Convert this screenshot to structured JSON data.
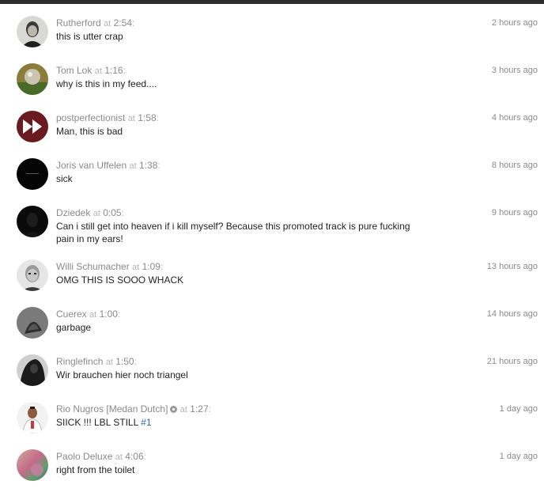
{
  "comments": [
    {
      "username": "Rutherford",
      "at": "at",
      "timestamp": "2:54",
      "colon": ":",
      "text": "this is utter crap",
      "posted": "2 hours ago",
      "avatar": "avatar-portrait-bw"
    },
    {
      "username": "Tom Lok",
      "at": "at",
      "timestamp": "1:16",
      "colon": ":",
      "text": "why is this in my feed....",
      "posted": "3 hours ago",
      "avatar": "avatar-disco-ball"
    },
    {
      "username": "postperfectionist",
      "at": "at",
      "timestamp": "1:58",
      "colon": ":",
      "text": "Man, this is bad",
      "posted": "4 hours ago",
      "avatar": "fast-forward-icon"
    },
    {
      "username": "Joris van Uffelen",
      "at": "at",
      "timestamp": "1:38",
      "colon": ":",
      "text": "sick",
      "posted": "8 hours ago",
      "avatar": "avatar-black"
    },
    {
      "username": "Dziedek",
      "at": "at",
      "timestamp": "0:05",
      "colon": ":",
      "text_line1": "Can i still get into heaven if i kill myself? Because this promoted track is pure fucking",
      "text_line2": "pain in my ears!",
      "posted": "9 hours ago",
      "avatar": "avatar-dark-silhouette"
    },
    {
      "username": "Willi Schumacher",
      "at": "at",
      "timestamp": "1:09",
      "colon": ":",
      "text": "OMG THIS IS SOOO WHACK",
      "posted": "13 hours ago",
      "avatar": "avatar-face-bw"
    },
    {
      "username": "Cuerex",
      "at": "at",
      "timestamp": "1:00",
      "colon": ":",
      "text": "garbage",
      "posted": "14 hours ago",
      "avatar": "avatar-hooded-figure"
    },
    {
      "username": "Ringlefinch",
      "at": "at",
      "timestamp": "1:50",
      "colon": ":",
      "text": "Wir brauchen hier noch triangel",
      "posted": "21 hours ago",
      "avatar": "avatar-dark-portrait"
    },
    {
      "username": "Rio Nugros [Medan Dutch]",
      "at": "at",
      "timestamp": "1:27",
      "colon": ":",
      "text": "SIICK !!! LBL STILL ",
      "hashtag": "#1",
      "posted": "1 day ago",
      "avatar": "avatar-person-photo",
      "pro_badge": "pro-badge-icon"
    },
    {
      "username": "Paolo Deluxe",
      "at": "at",
      "timestamp": "4:06",
      "colon": ":",
      "text": "right from the toilet",
      "posted": "1 day ago",
      "avatar": "avatar-colorful-blur"
    }
  ],
  "colors": {
    "username": "#8a8a8a",
    "text": "#222222",
    "hashtag": "#3366bb",
    "meta_light": "#b5b5b5"
  }
}
